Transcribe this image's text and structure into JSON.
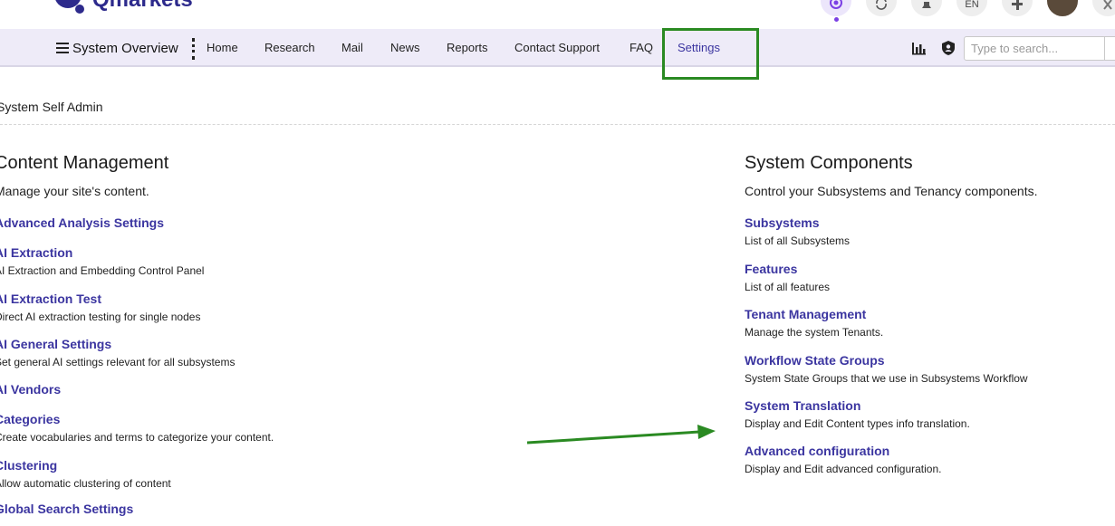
{
  "header": {
    "logo_text": "Qmarkets",
    "language": "EN"
  },
  "nav": {
    "system_overview_label": "System Overview",
    "links": [
      "Home",
      "Research",
      "Mail",
      "News",
      "Reports",
      "Contact Support",
      "FAQ",
      "Settings"
    ],
    "active": "Settings",
    "search_placeholder": "Type to search..."
  },
  "page": {
    "title": "System Self Admin"
  },
  "content_management": {
    "title": "Content Management",
    "description": "Manage your site's content.",
    "items": [
      {
        "title": "Advanced Analysis Settings",
        "desc": ""
      },
      {
        "title": "AI Extraction",
        "desc": "AI Extraction and Embedding Control Panel"
      },
      {
        "title": "AI Extraction Test",
        "desc": "Direct AI extraction testing for single nodes"
      },
      {
        "title": "AI General Settings",
        "desc": "Set general AI settings relevant for all subsystems"
      },
      {
        "title": "AI Vendors",
        "desc": ""
      },
      {
        "title": "Categories",
        "desc": "Create vocabularies and terms to categorize your content."
      },
      {
        "title": "Clustering",
        "desc": "Allow automatic clustering of content"
      },
      {
        "title": "Global Search Settings",
        "desc": ""
      }
    ]
  },
  "system_components": {
    "title": "System Components",
    "description": "Control your Subsystems and Tenancy components.",
    "items": [
      {
        "title": "Subsystems",
        "desc": "List of all Subsystems"
      },
      {
        "title": "Features",
        "desc": "List of all features"
      },
      {
        "title": "Tenant Management",
        "desc": "Manage the system Tenants."
      },
      {
        "title": "Workflow State Groups",
        "desc": "System State Groups that we use in Subsystems Workflow"
      },
      {
        "title": "System Translation",
        "desc": "Display and Edit Content types info translation."
      },
      {
        "title": "Advanced configuration",
        "desc": "Display and Edit advanced configuration."
      }
    ]
  },
  "colors": {
    "link": "#3b35a0",
    "nav_bg": "#eeebf8",
    "annotation": "#2a8a22"
  },
  "icons": [
    "logo-icon",
    "ai-assistant-icon",
    "sync-icon",
    "bell-icon",
    "plus-icon",
    "avatar",
    "close-icon",
    "bar-chart-icon",
    "user-shield-icon",
    "search-icon",
    "hamburger-icon"
  ]
}
